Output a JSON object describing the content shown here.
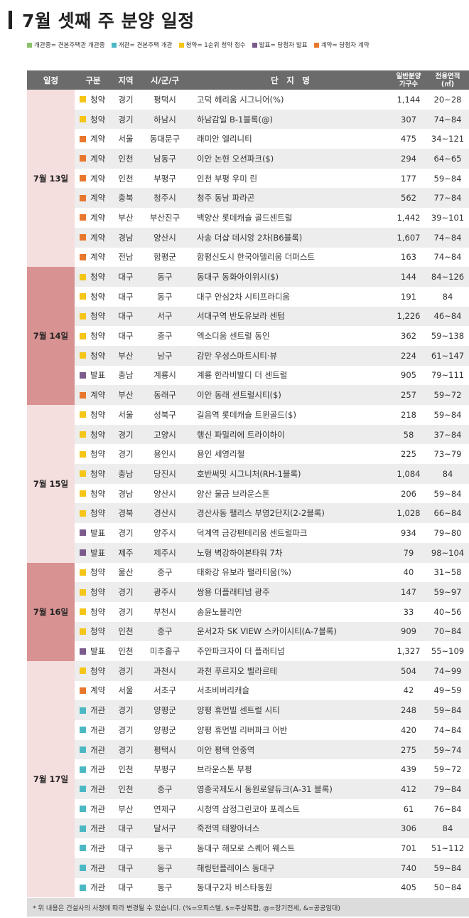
{
  "title": "7월 셋째 주 분양 일정",
  "legend": [
    {
      "label": "개관중= 견본주택관 개관중",
      "color": "#8dc26b"
    },
    {
      "label": "개관= 견본주택 개관",
      "color": "#4bb8c4"
    },
    {
      "label": "청약= 1순위 청약 접수",
      "color": "#f5c518"
    },
    {
      "label": "발표= 당첨자 발표",
      "color": "#7b5a8c"
    },
    {
      "label": "계약= 당첨자 계약",
      "color": "#e8772e"
    }
  ],
  "type_colors": {
    "청약": "#f5c518",
    "계약": "#e8772e",
    "발표": "#7b5a8c",
    "개관": "#4bb8c4"
  },
  "headers": {
    "date": "일정",
    "type": "구분",
    "region": "지역",
    "city": "시/군/구",
    "name": "단　지　명",
    "units_line1": "일반분양",
    "units_line2": "가구수",
    "area_line1": "전용면적",
    "area_line2": "(㎡)"
  },
  "groups": [
    {
      "date": "7월 13일",
      "date_bg": "#f5dede",
      "rows": [
        [
          "청약",
          "경기",
          "평택시",
          "고덕 헤리움 시그니어(%)",
          "1,144",
          "20~28"
        ],
        [
          "청약",
          "경기",
          "하남시",
          "하남감일 B-1블록(@)",
          "307",
          "74~84"
        ],
        [
          "계약",
          "서울",
          "동대문구",
          "래미안 엘리니티",
          "475",
          "34~121"
        ],
        [
          "계약",
          "인천",
          "남동구",
          "이안 논현 오션파크($)",
          "294",
          "64~65"
        ],
        [
          "계약",
          "인천",
          "부평구",
          "인천 부평 우미 린",
          "177",
          "59~84"
        ],
        [
          "계약",
          "충북",
          "청주시",
          "청주 동남 파라곤",
          "562",
          "77~84"
        ],
        [
          "계약",
          "부산",
          "부산진구",
          "백양산 롯데캐슬 골드센트럴",
          "1,442",
          "39~101"
        ],
        [
          "계약",
          "경남",
          "양산시",
          "사송 더샵 데시앙 2차(B6블록)",
          "1,607",
          "74~84"
        ],
        [
          "계약",
          "전남",
          "함평군",
          "함평신도시 한국아델리움 더퍼스트",
          "163",
          "74~84"
        ]
      ]
    },
    {
      "date": "7월 14일",
      "date_bg": "#d99292",
      "rows": [
        [
          "청약",
          "대구",
          "동구",
          "동대구 동화아이위시($)",
          "144",
          "84~126"
        ],
        [
          "청약",
          "대구",
          "동구",
          "대구 안심2차 시티프라디움",
          "191",
          "84"
        ],
        [
          "청약",
          "대구",
          "서구",
          "서대구역 반도유보라 센텀",
          "1,226",
          "46~84"
        ],
        [
          "청약",
          "대구",
          "중구",
          "엑소디움 센트럴 동인",
          "362",
          "59~138"
        ],
        [
          "청약",
          "부산",
          "남구",
          "감만 우성스마트시티·뷰",
          "224",
          "61~147"
        ],
        [
          "발표",
          "충남",
          "계룡시",
          "계룡 한라비발디 더 센트럴",
          "905",
          "79~111"
        ],
        [
          "계약",
          "부산",
          "동래구",
          "이안 동래 센트럴시티($)",
          "257",
          "59~72"
        ]
      ]
    },
    {
      "date": "7월 15일",
      "date_bg": "#f5dede",
      "rows": [
        [
          "청약",
          "서울",
          "성북구",
          "길음역 롯데캐슬 트윈골드($)",
          "218",
          "59~84"
        ],
        [
          "청약",
          "경기",
          "고양시",
          "행신 파밀리에 트라이하이",
          "58",
          "37~84"
        ],
        [
          "청약",
          "경기",
          "용인시",
          "용인 세영리첼",
          "225",
          "73~79"
        ],
        [
          "청약",
          "충남",
          "당진시",
          "호반써밋 시그니처(RH-1블록)",
          "1,084",
          "84"
        ],
        [
          "청약",
          "경남",
          "양산시",
          "양산 물금 브라운스톤",
          "206",
          "59~84"
        ],
        [
          "청약",
          "경북",
          "경산시",
          "경산사동 팰리스 부영2단지(2-2블록)",
          "1,028",
          "66~84"
        ],
        [
          "발표",
          "경기",
          "양주시",
          "덕계역 금강펜테리움 센트럴파크",
          "934",
          "79~80"
        ],
        [
          "발표",
          "제주",
          "제주시",
          "노형 벽강하이본타워 7차",
          "79",
          "98~104"
        ]
      ]
    },
    {
      "date": "7월 16일",
      "date_bg": "#d99292",
      "rows": [
        [
          "청약",
          "울산",
          "중구",
          "태화강 유보라 팰라티움(%)",
          "40",
          "31~58"
        ],
        [
          "청약",
          "경기",
          "광주시",
          "쌍용 더플래티넘 광주",
          "147",
          "59~97"
        ],
        [
          "청약",
          "경기",
          "부천시",
          "송윤노블리안",
          "33",
          "40~56"
        ],
        [
          "청약",
          "인천",
          "중구",
          "운서2차 SK VIEW 스카이시티(A-7블록)",
          "909",
          "70~84"
        ],
        [
          "발표",
          "인천",
          "미추홀구",
          "주안파크자이 더 플래티넘",
          "1,327",
          "55~109"
        ]
      ]
    },
    {
      "date": "7월 17일",
      "date_bg": "#f5dede",
      "rows": [
        [
          "청약",
          "경기",
          "과천시",
          "과천 푸르지오 벨라르테",
          "504",
          "74~99"
        ],
        [
          "계약",
          "서울",
          "서초구",
          "서초비버리캐슬",
          "42",
          "49~59"
        ],
        [
          "개관",
          "경기",
          "양평군",
          "양평 휴먼빌 센트럴 시티",
          "248",
          "59~84"
        ],
        [
          "개관",
          "경기",
          "양평군",
          "양평 휴먼빌 리버파크 어반",
          "420",
          "74~84"
        ],
        [
          "개관",
          "경기",
          "평택시",
          "이안 평택 안중역",
          "275",
          "59~74"
        ],
        [
          "개관",
          "인천",
          "부평구",
          " 브라운스톤 부평",
          "439",
          "59~72"
        ],
        [
          "개관",
          "인천",
          "중구",
          "영종국제도시 동원로얄듀크(A-31 블록)",
          "412",
          "79~84"
        ],
        [
          "개관",
          "부산",
          "연제구",
          "시청역 삼정그린코아 포레스트",
          "61",
          "76~84"
        ],
        [
          "개관",
          "대구",
          "달서구",
          "죽전역 태왕아너스",
          "306",
          "84"
        ],
        [
          "개관",
          "대구",
          "동구",
          "동대구 해모로 스퀘어 웨스트",
          "701",
          "51~112"
        ],
        [
          "개관",
          "대구",
          "동구",
          " 해링턴플레이스 동대구",
          "740",
          "59~84"
        ],
        [
          "개관",
          "대구",
          "동구",
          "동대구2차 비스타동원",
          "405",
          "50~84"
        ]
      ]
    }
  ],
  "footnote": "* 위 내용은 건설사의 사정에 따라 변경될 수 있습니다. (%=오피스텔, $=주상복합, @=장기전세, &=공공임대)"
}
